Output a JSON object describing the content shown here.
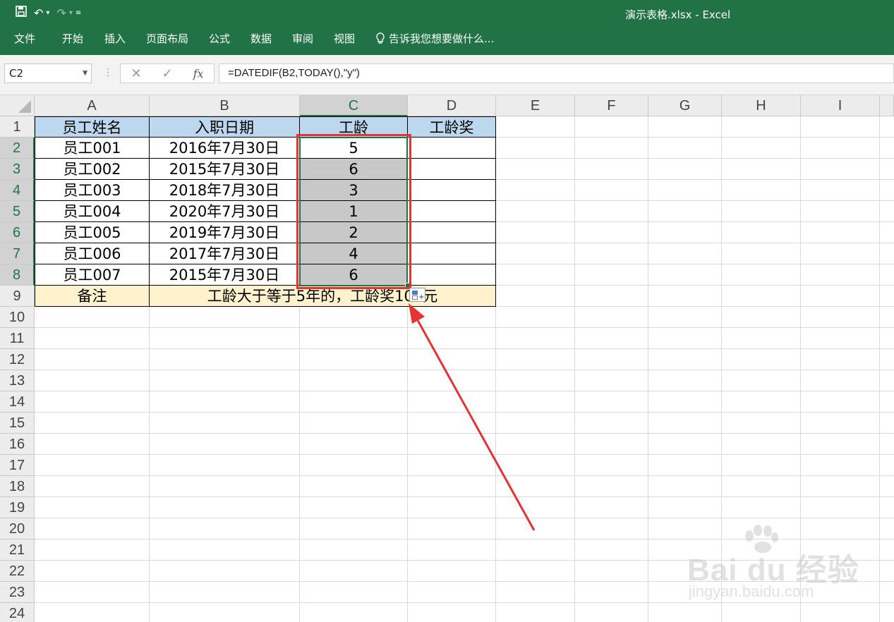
{
  "window": {
    "title": "演示表格.xlsx - Excel"
  },
  "ribbon": {
    "tabs": [
      "文件",
      "开始",
      "插入",
      "页面布局",
      "公式",
      "数据",
      "审阅",
      "视图"
    ],
    "tell_me": "告诉我您想要做什么..."
  },
  "formula_bar": {
    "name_box": "C2",
    "formula": "=DATEDIF(B2,TODAY(),\"y\")"
  },
  "sheet": {
    "columns": [
      "A",
      "B",
      "C",
      "D",
      "E",
      "F",
      "G",
      "H",
      "I"
    ],
    "rows": [
      "1",
      "2",
      "3",
      "4",
      "5",
      "6",
      "7",
      "8",
      "9",
      "10",
      "11",
      "12",
      "13",
      "14",
      "15",
      "16",
      "17",
      "18",
      "19",
      "20",
      "21",
      "22",
      "23",
      "24"
    ],
    "header": {
      "name": "员工姓名",
      "date": "入职日期",
      "years": "工龄",
      "bonus": "工龄奖"
    },
    "data": [
      {
        "name": "员工001",
        "date": "2016年7月30日",
        "years": "5"
      },
      {
        "name": "员工002",
        "date": "2015年7月30日",
        "years": "6"
      },
      {
        "name": "员工003",
        "date": "2018年7月30日",
        "years": "3"
      },
      {
        "name": "员工004",
        "date": "2020年7月30日",
        "years": "1"
      },
      {
        "name": "员工005",
        "date": "2019年7月30日",
        "years": "2"
      },
      {
        "name": "员工006",
        "date": "2017年7月30日",
        "years": "4"
      },
      {
        "name": "员工007",
        "date": "2015年7月30日",
        "years": "6"
      }
    ],
    "note_label": "备注",
    "note_text": "工龄大于等于5年的，工龄奖100元",
    "selected_column": "C",
    "selected_rows": [
      "2",
      "3",
      "4",
      "5",
      "6",
      "7",
      "8"
    ]
  },
  "watermark": {
    "main": "Bai du 经验",
    "sub": "jingyan.baidu.com"
  },
  "colors": {
    "excel_green": "#217346",
    "header_fill": "#bdd7ee",
    "note_fill": "#fff2cc",
    "annotation_red": "#e53333"
  }
}
